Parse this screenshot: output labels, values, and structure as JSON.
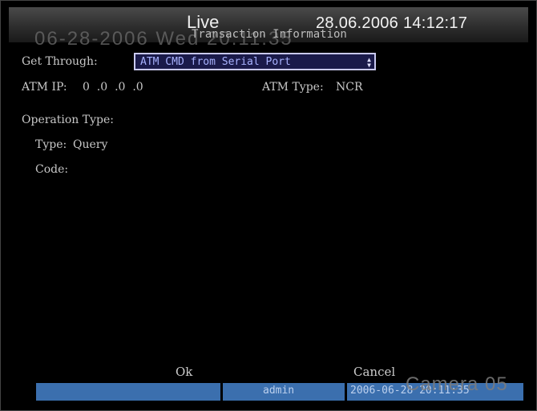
{
  "header": {
    "live_label": "Live",
    "datetime": "28.06.2006 14:12:17",
    "osd_time": "06-28-2006 Wed 20:11:35",
    "page_title": "Transaction Information"
  },
  "form": {
    "get_through_label": "Get Through:",
    "get_through_value": "ATM CMD from Serial Port",
    "atm_ip_label": "ATM IP:",
    "atm_ip_value": "0  .0  .0  .0",
    "atm_type_label": "ATM Type:",
    "atm_type_value": "NCR",
    "operation_type_label": "Operation Type:",
    "type_label": "Type:",
    "type_value": "Query",
    "code_label": "Code:"
  },
  "buttons": {
    "ok": "Ok",
    "cancel": "Cancel"
  },
  "status_bar": {
    "user": "admin",
    "datetime": "2006-06-28 20:11:35"
  },
  "overlay": {
    "camera": "Camera 05"
  }
}
